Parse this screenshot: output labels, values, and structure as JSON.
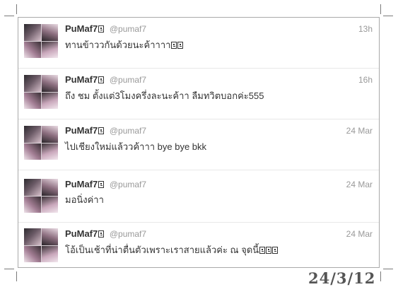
{
  "tweets": [
    {
      "name": "PuMaf7",
      "handle": "@pumaf7",
      "time": "13h",
      "text": "ทานข้าววกันด้วยนะค้าาาา"
    },
    {
      "name": "PuMaf7",
      "handle": "@pumaf7",
      "time": "16h",
      "text": "ถึง ชม ตั้งแต่3โมงครึ่งละนะค้าา ลืมทวิตบอกค่ะ555"
    },
    {
      "name": "PuMaf7",
      "handle": "@pumaf7",
      "time": "24 Mar",
      "text": "ไปเชียงใหม่แล้ววค้าาา bye bye bkk"
    },
    {
      "name": "PuMaf7",
      "handle": "@pumaf7",
      "time": "24 Mar",
      "text": "มอนิ่งค่าา"
    },
    {
      "name": "PuMaf7",
      "handle": "@pumaf7",
      "time": "24 Mar",
      "text": "โอ้เป็นเช้าที่น่าตื่นตัวเพราะเราสายแล้วค่ะ ณ จุดนี้"
    }
  ],
  "footer": {
    "date": "24/3/12"
  }
}
